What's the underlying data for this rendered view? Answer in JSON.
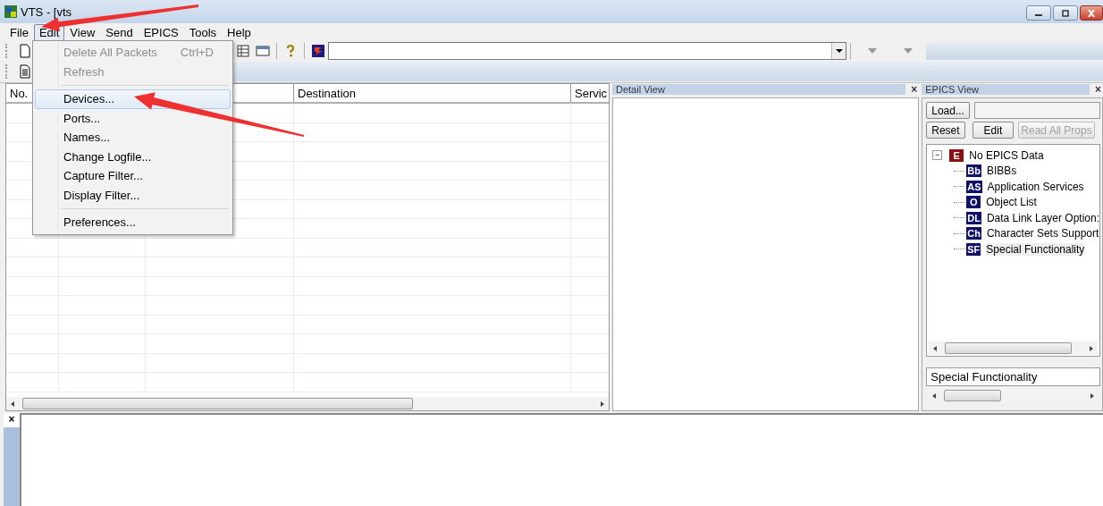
{
  "window": {
    "title": "VTS - [vts"
  },
  "menu_bar": [
    {
      "label": "File",
      "selected": false
    },
    {
      "label": "Edit",
      "selected": true
    },
    {
      "label": "View",
      "selected": false
    },
    {
      "label": "Send",
      "selected": false
    },
    {
      "label": "EPICS",
      "selected": false
    },
    {
      "label": "Tools",
      "selected": false
    },
    {
      "label": "Help",
      "selected": false
    }
  ],
  "edit_menu": [
    {
      "kind": "item",
      "label": "Delete All Packets",
      "shortcut": "Ctrl+D",
      "disabled": true,
      "selected": false
    },
    {
      "kind": "item",
      "label": "Refresh",
      "disabled": true,
      "selected": false
    },
    {
      "kind": "separator"
    },
    {
      "kind": "item",
      "label": "Devices...",
      "disabled": false,
      "selected": true
    },
    {
      "kind": "item",
      "label": "Ports...",
      "disabled": false,
      "selected": false
    },
    {
      "kind": "item",
      "label": "Names...",
      "disabled": false,
      "selected": false
    },
    {
      "kind": "item",
      "label": "Change Logfile...",
      "disabled": false,
      "selected": false
    },
    {
      "kind": "item",
      "label": "Capture Filter...",
      "disabled": false,
      "selected": false
    },
    {
      "kind": "item",
      "label": "Display Filter...",
      "disabled": false,
      "selected": false
    },
    {
      "kind": "separator"
    },
    {
      "kind": "item",
      "label": "Preferences...",
      "disabled": false,
      "selected": false
    }
  ],
  "packet_list": {
    "columns": [
      {
        "label": "No."
      },
      {},
      {},
      {
        "label": "Destination"
      },
      {
        "label": "Servic"
      }
    ]
  },
  "detail_view": {
    "title": "Detail View",
    "close": "×"
  },
  "epics_view": {
    "title": "EPICS View",
    "close": "×",
    "buttons": [
      {
        "label": "Load...",
        "disabled": false
      },
      {
        "label": "Reset",
        "disabled": false
      },
      {
        "label": "Edit",
        "disabled": false
      },
      {
        "label": "Read All Props",
        "disabled": true
      }
    ],
    "tree": {
      "badge": "E",
      "label": "No EPICS Data",
      "expanded": true,
      "expander": "−",
      "children": [
        {
          "badge": "Bb",
          "label": "BIBBs",
          "selected": false
        },
        {
          "badge": "AS",
          "label": "Application Services",
          "selected": false
        },
        {
          "badge": "O",
          "label": "Object List",
          "selected": false
        },
        {
          "badge": "DL",
          "label": "Data Link Layer Option:",
          "selected": false
        },
        {
          "badge": "Ch",
          "label": "Character Sets Support",
          "selected": false
        },
        {
          "badge": "SF",
          "label": "Special Functionality",
          "selected": true
        }
      ]
    },
    "selection_field": "Special Functionality"
  },
  "bottom_pane": {
    "close": "×"
  }
}
